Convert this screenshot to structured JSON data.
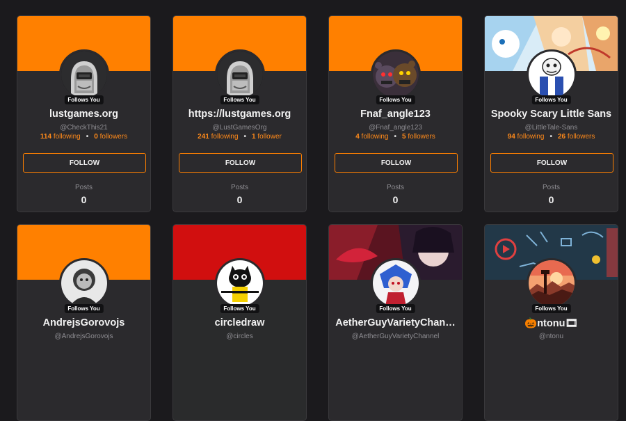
{
  "follows_badge": "Follows You",
  "follow_button": "FOLLOW",
  "posts_label": "Posts",
  "colors": {
    "accent": "#ff8000",
    "page_bg": "#1b1a1d",
    "card_bg": "#2b2a2d",
    "red_banner": "#d10f0f"
  },
  "cards": [
    {
      "name": "lustgames.org",
      "handle": "@CheckThis21",
      "following": "114",
      "following_label": "following",
      "followers": "0",
      "followers_label": "followers",
      "posts": "0",
      "avatar_icon": "hooded-robot-avatar-icon"
    },
    {
      "name": "https://lustgames.org",
      "handle": "@LustGamesOrg",
      "following": "241",
      "following_label": "following",
      "followers": "1",
      "followers_label": "follower",
      "posts": "0",
      "avatar_icon": "hooded-robot-avatar-icon"
    },
    {
      "name": "Fnaf_angle123",
      "handle": "@Fnaf_angle123",
      "following": "4",
      "following_label": "following",
      "followers": "5",
      "followers_label": "followers",
      "posts": "0",
      "avatar_icon": "animatronic-avatar-icon"
    },
    {
      "name": "Spooky Scary Little Sans",
      "handle": "@LittleTale-Sans",
      "following": "94",
      "following_label": "following",
      "followers": "26",
      "followers_label": "followers",
      "posts": "0",
      "avatar_icon": "skeleton-avatar-icon"
    },
    {
      "name": "AndrejsGorovojs",
      "handle": "@AndrejsGorovojs",
      "avatar_icon": "person-avatar-icon"
    },
    {
      "name": "circledraw",
      "handle": "@circles",
      "avatar_icon": "cat-avatar-icon"
    },
    {
      "name": "AetherGuyVarietyChan…",
      "handle": "@AetherGuyVarietyChannel",
      "avatar_icon": "anime-avatar-icon"
    },
    {
      "name": "ntonu",
      "name_prefix": "🎃",
      "name_suffix": "🎞",
      "handle": "@ntonu",
      "avatar_icon": "sunset-tower-avatar-icon"
    }
  ]
}
